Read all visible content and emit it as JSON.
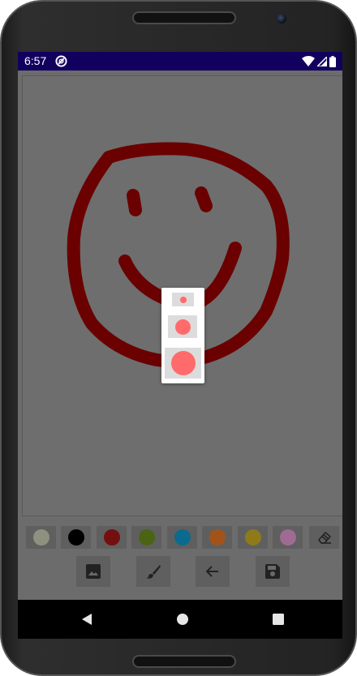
{
  "status_bar": {
    "time": "6:57",
    "background": "#12005e"
  },
  "canvas": {
    "background": "#6e6e6e",
    "stroke_color": "#6b0000",
    "drawing": "smiley-face"
  },
  "brush_size_popup": {
    "options": [
      {
        "name": "small",
        "selected": false
      },
      {
        "name": "medium",
        "selected": false
      },
      {
        "name": "large",
        "selected": false
      }
    ],
    "dot_color": "#ff6b6b"
  },
  "palette": {
    "colors": [
      {
        "name": "light-gray",
        "hex": "#8f9180"
      },
      {
        "name": "black",
        "hex": "#000000"
      },
      {
        "name": "dark-red",
        "hex": "#740f0f"
      },
      {
        "name": "olive-green",
        "hex": "#4b6414"
      },
      {
        "name": "blue",
        "hex": "#0c6a8e"
      },
      {
        "name": "orange",
        "hex": "#a3531a"
      },
      {
        "name": "mustard",
        "hex": "#8e7a1a"
      },
      {
        "name": "pink",
        "hex": "#9f6b93"
      }
    ],
    "eraser_icon": "eraser-icon"
  },
  "toolbar": {
    "buttons": [
      {
        "name": "gallery-button",
        "icon": "image-icon"
      },
      {
        "name": "brush-button",
        "icon": "brush-icon"
      },
      {
        "name": "undo-button",
        "icon": "arrow-left-icon"
      },
      {
        "name": "save-button",
        "icon": "save-icon"
      }
    ]
  },
  "navigation_bar": {
    "buttons": [
      "back-icon",
      "home-icon",
      "recents-icon"
    ]
  }
}
